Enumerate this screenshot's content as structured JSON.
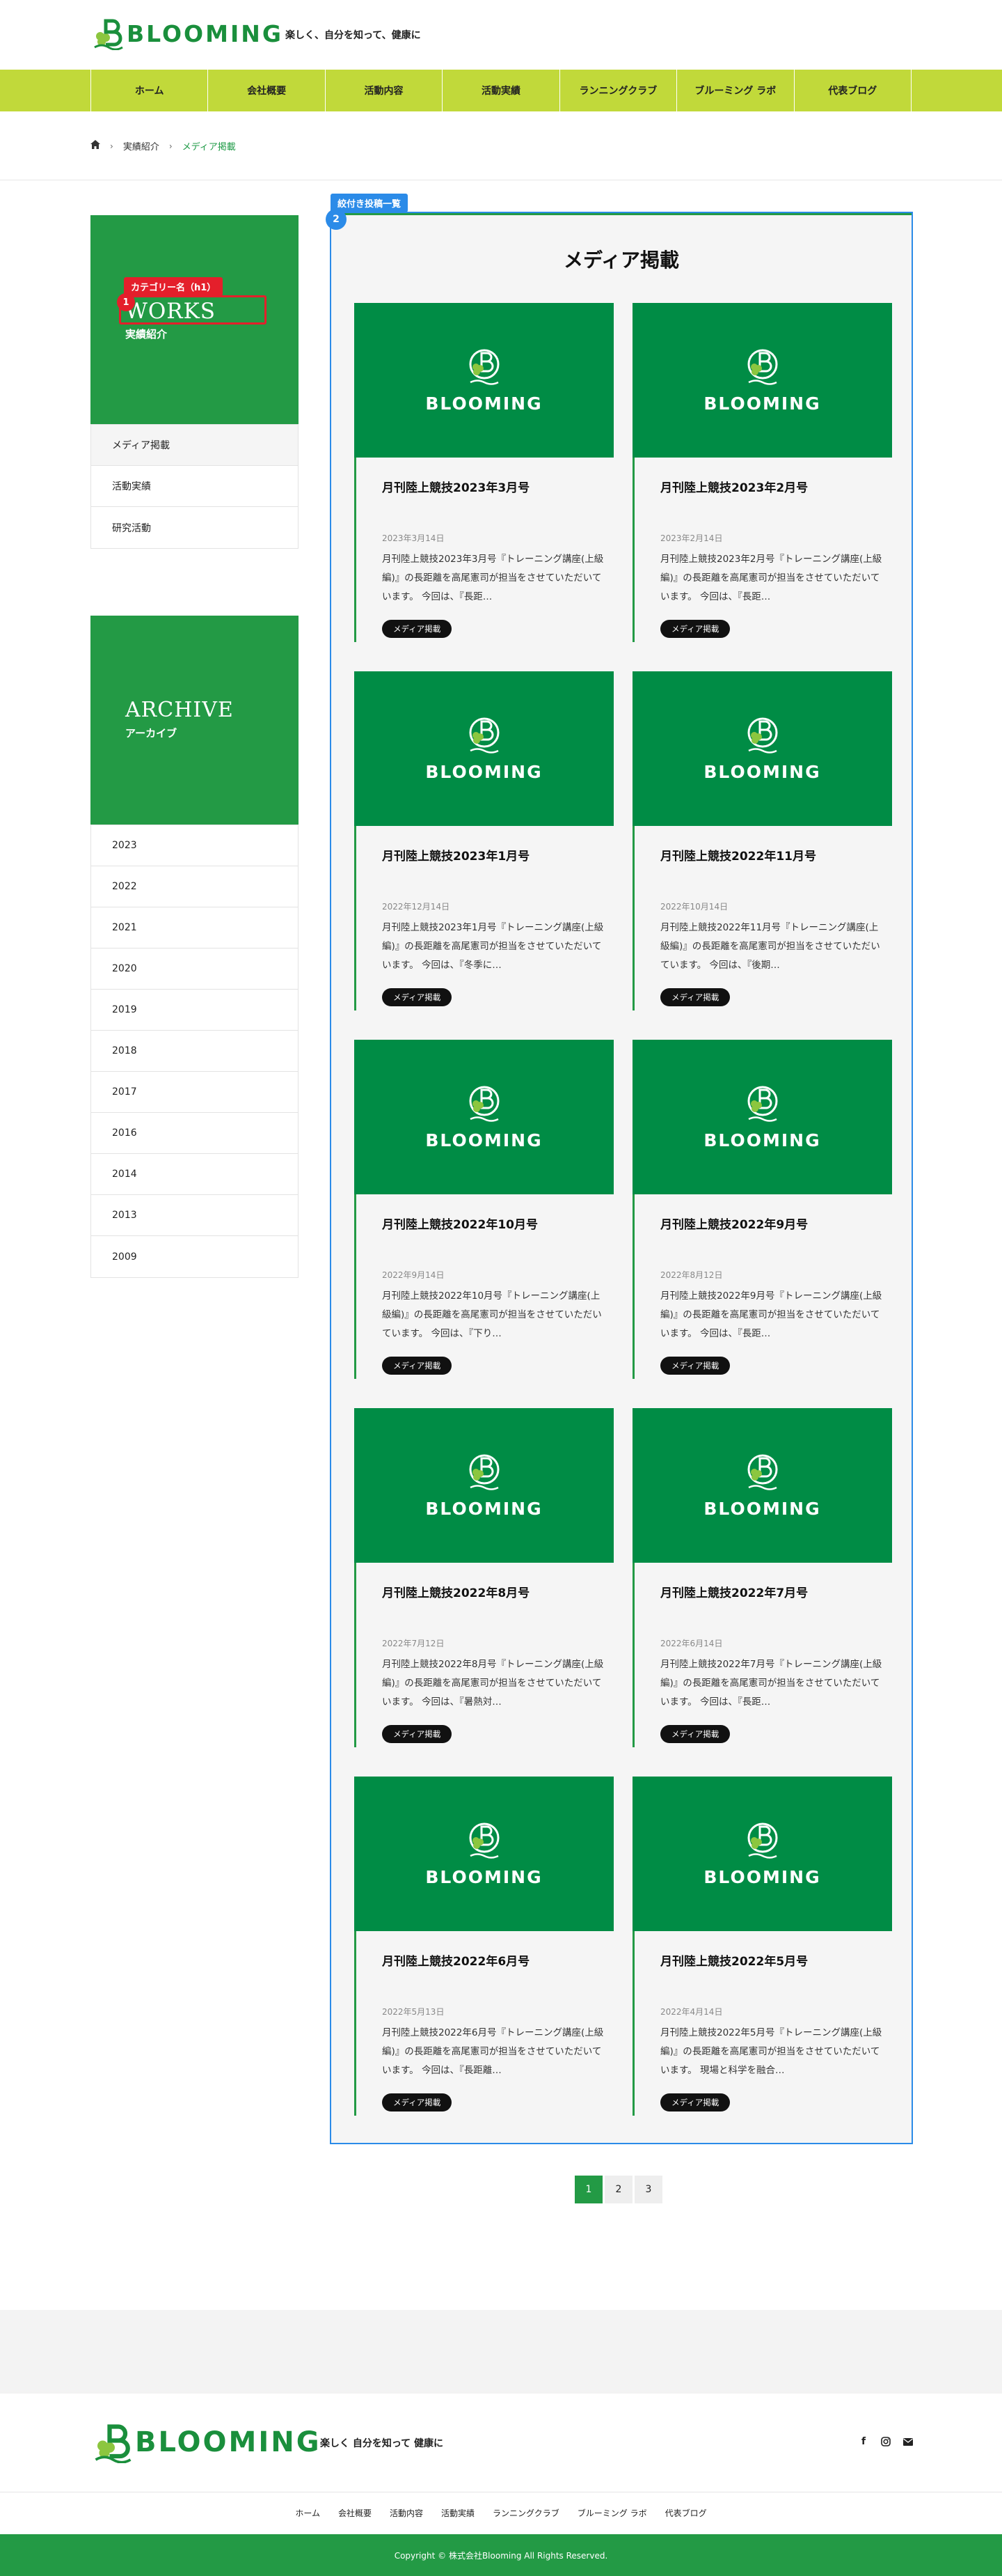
{
  "header": {
    "logo_text": "BLOOMING",
    "tagline": "楽しく、自分を知って、健康に"
  },
  "nav": [
    {
      "label": "ホーム"
    },
    {
      "label": "会社概要"
    },
    {
      "label": "活動内容"
    },
    {
      "label": "活動実績"
    },
    {
      "label": "ランニングクラブ"
    },
    {
      "label": "ブルーミング ラボ"
    },
    {
      "label": "代表ブログ"
    }
  ],
  "breadcrumb": {
    "home_icon": "home-icon",
    "parent": "実績紹介",
    "current": "メディア掲載"
  },
  "sidebar": {
    "category_title": "WORKS",
    "category_sub": "実績紹介",
    "annotation_label": "カテゴリー名（h1）",
    "annotation_number": "1",
    "category_items": [
      {
        "label": "メディア掲載"
      },
      {
        "label": "活動実績"
      },
      {
        "label": "研究活動"
      }
    ],
    "archive_title": "ARCHIVE",
    "archive_sub": "アーカイブ",
    "archive_items": [
      {
        "label": "2023"
      },
      {
        "label": "2022"
      },
      {
        "label": "2021"
      },
      {
        "label": "2020"
      },
      {
        "label": "2019"
      },
      {
        "label": "2018"
      },
      {
        "label": "2017"
      },
      {
        "label": "2016"
      },
      {
        "label": "2014"
      },
      {
        "label": "2013"
      },
      {
        "label": "2009"
      }
    ]
  },
  "main": {
    "annotation_label": "絞付き投稿一覧",
    "annotation_number": "2",
    "title": "メディア掲載",
    "thumb_text": "BLOOMING",
    "posts": [
      {
        "title": "月刊陸上競技2023年3月号",
        "date": "2023年3月14日",
        "excerpt": "月刊陸上競技2023年3月号『トレーニング講座(上級編)』の長距離を高尾憲司が担当をさせていただいています。 今回は、『長距…",
        "category": "メディア掲載"
      },
      {
        "title": "月刊陸上競技2023年2月号",
        "date": "2023年2月14日",
        "excerpt": "月刊陸上競技2023年2月号『トレーニング講座(上級編)』の長距離を高尾憲司が担当をさせていただいています。 今回は、『長距…",
        "category": "メディア掲載"
      },
      {
        "title": "月刊陸上競技2023年1月号",
        "date": "2022年12月14日",
        "excerpt": "月刊陸上競技2023年1月号『トレーニング講座(上級編)』の長距離を高尾憲司が担当をさせていただいています。 今回は、『冬季に…",
        "category": "メディア掲載"
      },
      {
        "title": "月刊陸上競技2022年11月号",
        "date": "2022年10月14日",
        "excerpt": "月刊陸上競技2022年11月号『トレーニング講座(上級編)』の長距離を高尾憲司が担当をさせていただいています。 今回は、『後期…",
        "category": "メディア掲載"
      },
      {
        "title": "月刊陸上競技2022年10月号",
        "date": "2022年9月14日",
        "excerpt": "月刊陸上競技2022年10月号『トレーニング講座(上級編)』の長距離を高尾憲司が担当をさせていただいています。 今回は、『下り…",
        "category": "メディア掲載"
      },
      {
        "title": "月刊陸上競技2022年9月号",
        "date": "2022年8月12日",
        "excerpt": "月刊陸上競技2022年9月号『トレーニング講座(上級編)』の長距離を高尾憲司が担当をさせていただいています。 今回は、『長距…",
        "category": "メディア掲載"
      },
      {
        "title": "月刊陸上競技2022年8月号",
        "date": "2022年7月12日",
        "excerpt": "月刊陸上競技2022年8月号『トレーニング講座(上級編)』の長距離を高尾憲司が担当をさせていただいています。 今回は、『暑熱対…",
        "category": "メディア掲載"
      },
      {
        "title": "月刊陸上競技2022年7月号",
        "date": "2022年6月14日",
        "excerpt": "月刊陸上競技2022年7月号『トレーニング講座(上級編)』の長距離を高尾憲司が担当をさせていただいています。 今回は、『長距…",
        "category": "メディア掲載"
      },
      {
        "title": "月刊陸上競技2022年6月号",
        "date": "2022年5月13日",
        "excerpt": "月刊陸上競技2022年6月号『トレーニング講座(上級編)』の長距離を高尾憲司が担当をさせていただいています。 今回は、『長距離…",
        "category": "メディア掲載"
      },
      {
        "title": "月刊陸上競技2022年5月号",
        "date": "2022年4月14日",
        "excerpt": "月刊陸上競技2022年5月号『トレーニング講座(上級編)』の長距離を高尾憲司が担当をさせていただいています。 現場と科学を融合…",
        "category": "メディア掲載"
      }
    ]
  },
  "pagination": [
    "1",
    "2",
    "3"
  ],
  "footer": {
    "logo_text": "BLOOMING",
    "tagline": "楽しく 自分を知って 健康に",
    "social_icons": [
      "facebook-icon",
      "instagram-icon",
      "mail-icon"
    ],
    "nav": [
      {
        "label": "ホーム"
      },
      {
        "label": "会社概要"
      },
      {
        "label": "活動内容"
      },
      {
        "label": "活動実績"
      },
      {
        "label": "ランニングクラブ"
      },
      {
        "label": "ブルーミング ラボ"
      },
      {
        "label": "代表ブログ"
      }
    ],
    "copyright": "Copyright © 株式会社Blooming All Rights Reserved."
  },
  "colors": {
    "brand_green": "#239a45",
    "nav_lime": "#c1d93a",
    "thumb_green": "#008c45",
    "annotation_red": "#e41f2b",
    "annotation_blue": "#2b8be8"
  }
}
